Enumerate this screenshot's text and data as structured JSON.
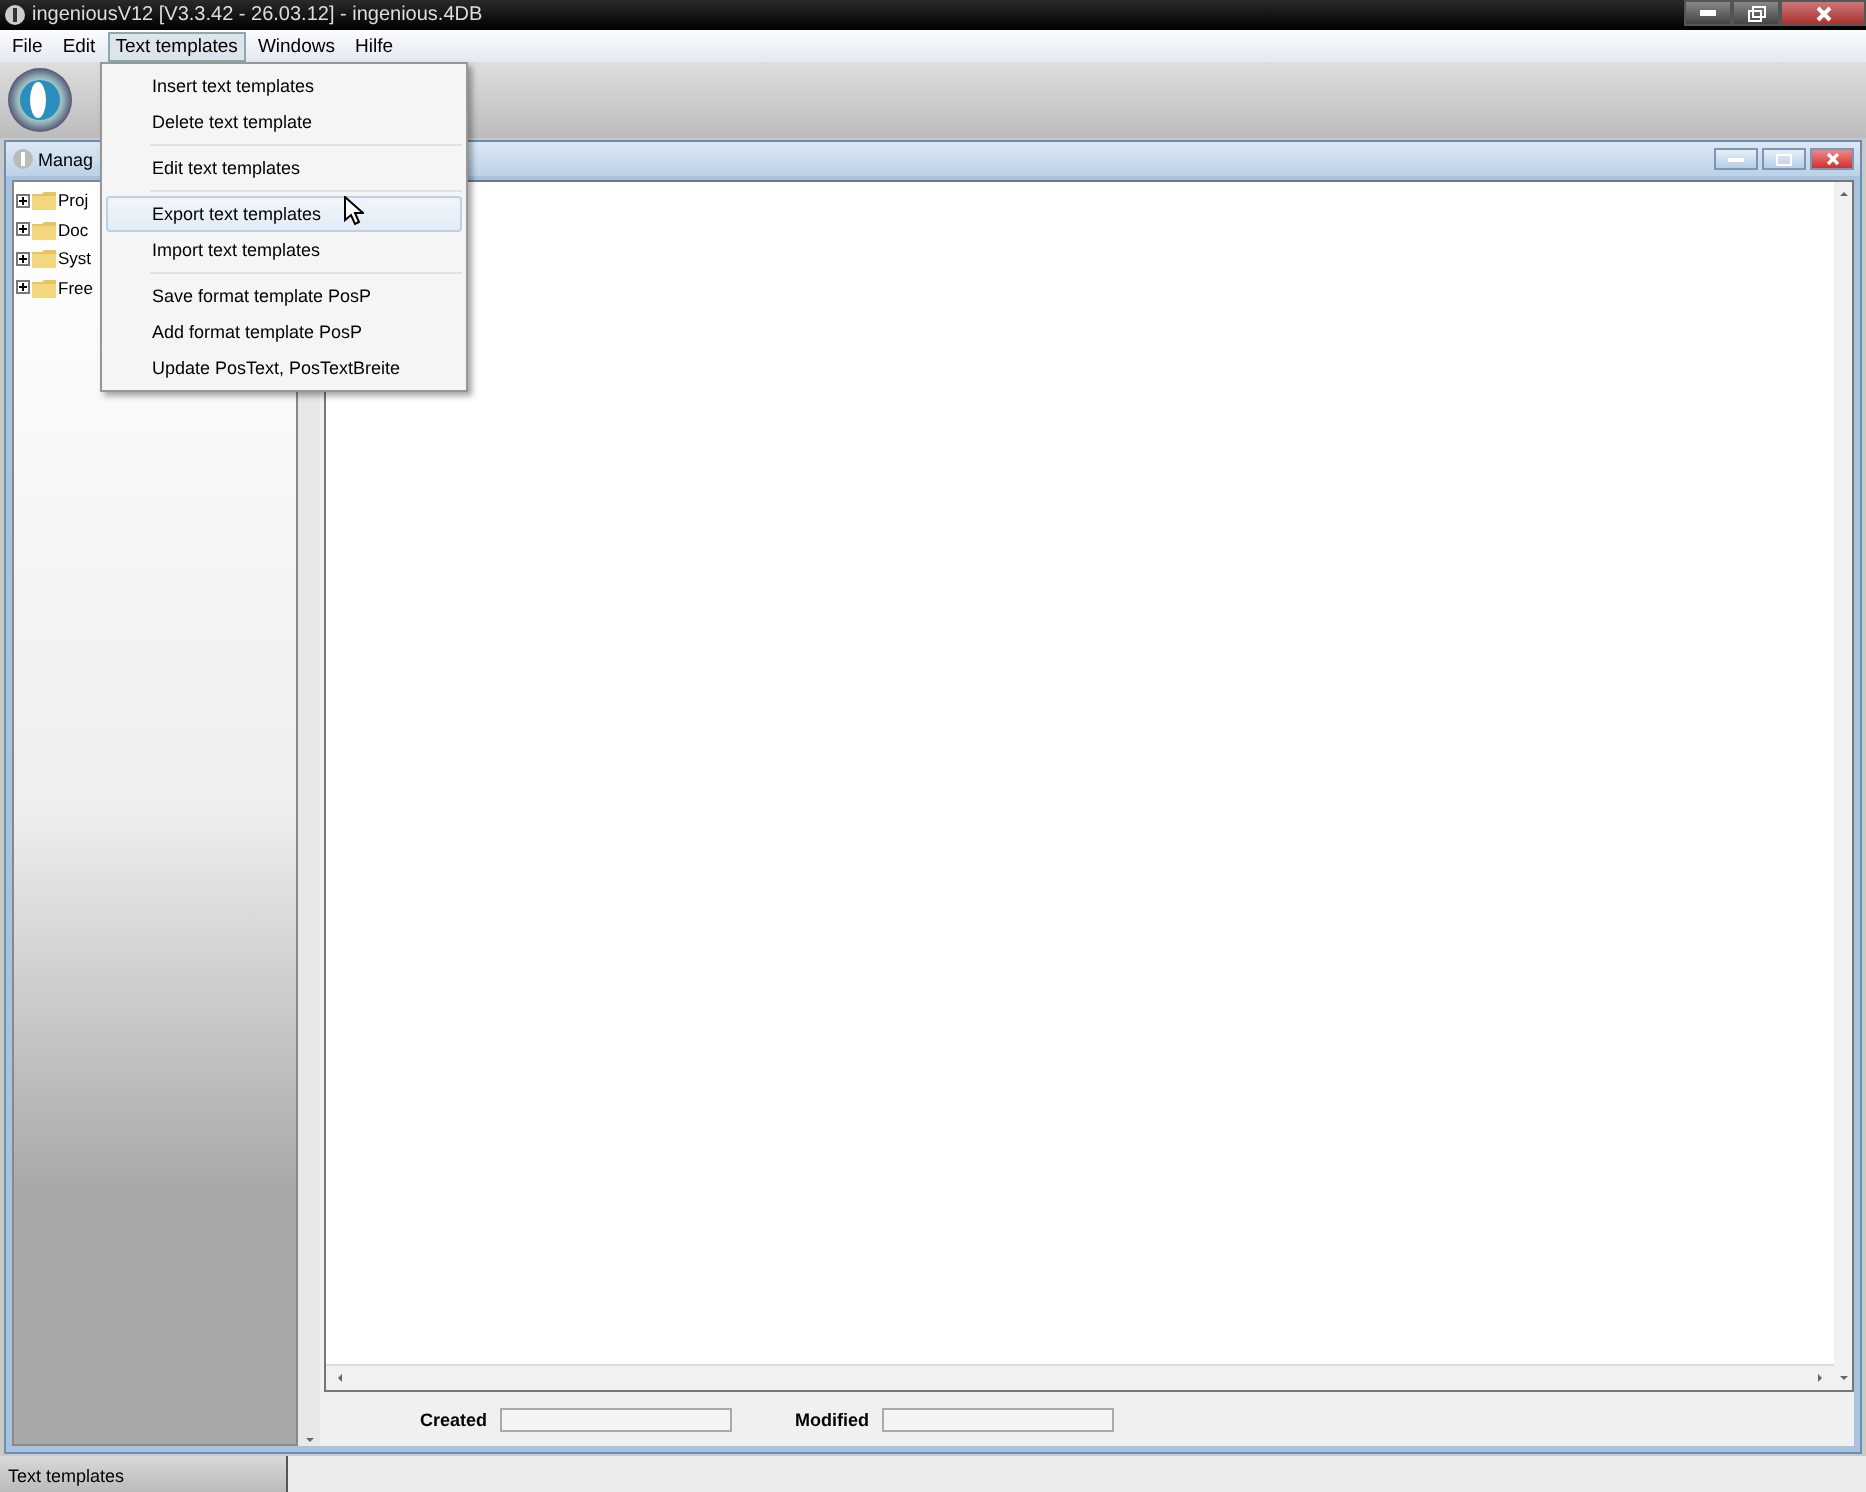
{
  "window": {
    "title": "ingeniousV12 [V3.3.42 - 26.03.12] - ingenious.4DB"
  },
  "menu_bar": [
    {
      "label": "File",
      "selected": false
    },
    {
      "label": "Edit",
      "selected": false
    },
    {
      "label": "Text templates",
      "selected": true
    },
    {
      "label": "Windows",
      "selected": false
    },
    {
      "label": "Hilfe",
      "selected": false
    }
  ],
  "dropdown": [
    {
      "kind": "item",
      "label": "Insert text templates",
      "selected": false
    },
    {
      "kind": "item",
      "label": "Delete text template",
      "selected": false
    },
    {
      "kind": "separator"
    },
    {
      "kind": "item",
      "label": "Edit text templates",
      "selected": false
    },
    {
      "kind": "separator"
    },
    {
      "kind": "item",
      "label": "Export text templates",
      "selected": true
    },
    {
      "kind": "item",
      "label": "Import text templates",
      "selected": false
    },
    {
      "kind": "separator"
    },
    {
      "kind": "item",
      "label": "Save format template PosP",
      "selected": false
    },
    {
      "kind": "item",
      "label": "Add format template PosP",
      "selected": false
    },
    {
      "kind": "item",
      "label": "Update PosText, PosTextBreite",
      "selected": false
    }
  ],
  "child_window": {
    "title": "Manag"
  },
  "tree": [
    {
      "label": "Proj",
      "expanded": false
    },
    {
      "label": "Doc",
      "expanded": false
    },
    {
      "label": "Syst",
      "expanded": false
    },
    {
      "label": "Free",
      "expanded": false
    }
  ],
  "footer": {
    "fields": [
      {
        "label": "Created"
      },
      {
        "label": "Modified"
      }
    ]
  },
  "status_bar": {
    "text": "Text templates"
  }
}
